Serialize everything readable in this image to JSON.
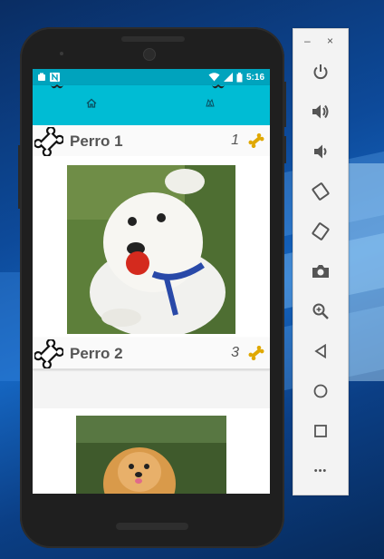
{
  "status_bar": {
    "time": "5:16"
  },
  "nav": {
    "home_icon": "home-icon",
    "profile_icon": "dog-profile-icon"
  },
  "dogs": [
    {
      "name": "Perro 1",
      "count": "1"
    },
    {
      "name": "Perro 2",
      "count": "3"
    },
    {
      "name": "",
      "count": ""
    }
  ],
  "colors": {
    "status_bar": "#00a3bd",
    "app_bar": "#00bcd4",
    "bone_gold": "#e0a800",
    "text_gray": "#555555"
  },
  "emulator_toolbar": {
    "minimize_label": "–",
    "close_label": "×",
    "more_label": "•••",
    "buttons": [
      "power-icon",
      "volume-up-icon",
      "volume-down-icon",
      "rotate-left-icon",
      "rotate-right-icon",
      "camera-icon",
      "zoom-icon",
      "back-icon",
      "home-circle-icon",
      "overview-icon",
      "more-icon"
    ]
  }
}
